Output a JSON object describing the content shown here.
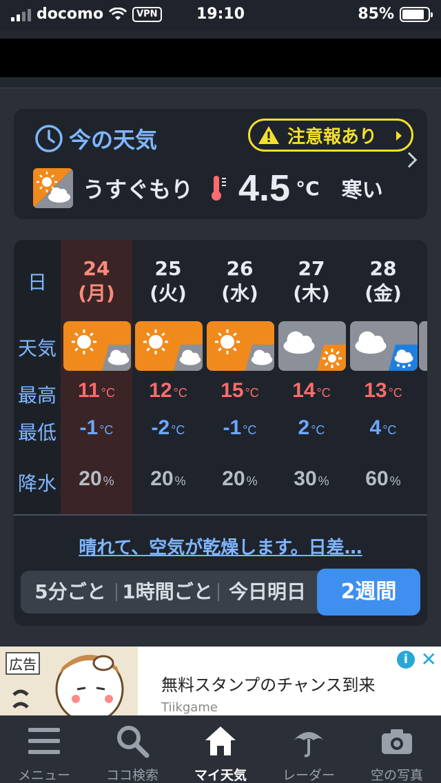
{
  "status_bar": {
    "carrier": "docomo",
    "vpn": "VPN",
    "time": "19:10",
    "battery": "85%",
    "battery_level": 0.85
  },
  "now": {
    "title": "今の天気",
    "alert": "注意報あり",
    "condition": "うすぐもり",
    "temp": "4.5",
    "unit": "°C",
    "feel": "寒い"
  },
  "forecast": {
    "row_labels": {
      "day": "日",
      "weather": "天気",
      "high": "最高",
      "low": "最低",
      "precip": "降水"
    },
    "temp_unit": "°C",
    "precip_unit": "%",
    "days": [
      {
        "date": "24",
        "dow": "(月)",
        "weather": "晴れ時々くもり",
        "high": "11",
        "low": "-1",
        "precip": "20"
      },
      {
        "date": "25",
        "dow": "(火)",
        "weather": "晴れ時々くもり",
        "high": "12",
        "low": "-2",
        "precip": "20"
      },
      {
        "date": "26",
        "dow": "(水)",
        "weather": "晴れ時々くもり",
        "high": "15",
        "low": "-1",
        "precip": "20"
      },
      {
        "date": "27",
        "dow": "(木)",
        "weather": "くもり時々晴れ",
        "high": "14",
        "low": "2",
        "precip": "30"
      },
      {
        "date": "28",
        "dow": "(金)",
        "weather": "くもり時々雨",
        "high": "13",
        "low": "4",
        "precip": "60"
      }
    ],
    "summary": "晴れて、空気が乾燥します。日差…",
    "tabs": {
      "five_min": "5分ごと",
      "hourly": "1時間ごと",
      "today_tomorrow": "今日明日",
      "two_weeks": "2週間"
    }
  },
  "ad": {
    "badge": "広告",
    "text": "無料スタンプのチャンス到来",
    "advertiser": "Tiikgame",
    "info": "i",
    "close": "✕"
  },
  "tabbar": {
    "items": [
      {
        "label": "メニュー",
        "icon": "menu-icon"
      },
      {
        "label": "ココ検索",
        "icon": "search-icon"
      },
      {
        "label": "マイ天気",
        "icon": "home-icon"
      },
      {
        "label": "レーダー",
        "icon": "umbrella-icon"
      },
      {
        "label": "空の写真",
        "icon": "camera-icon"
      }
    ],
    "active": "マイ天気"
  },
  "colors": {
    "accent_blue": "#3f8ff0",
    "label_blue": "#7fb6ff",
    "high_red": "#ff6b6b",
    "low_blue": "#6aa8ff",
    "alert_yellow": "#f3df2e",
    "sun_orange": "#f08a1c"
  }
}
